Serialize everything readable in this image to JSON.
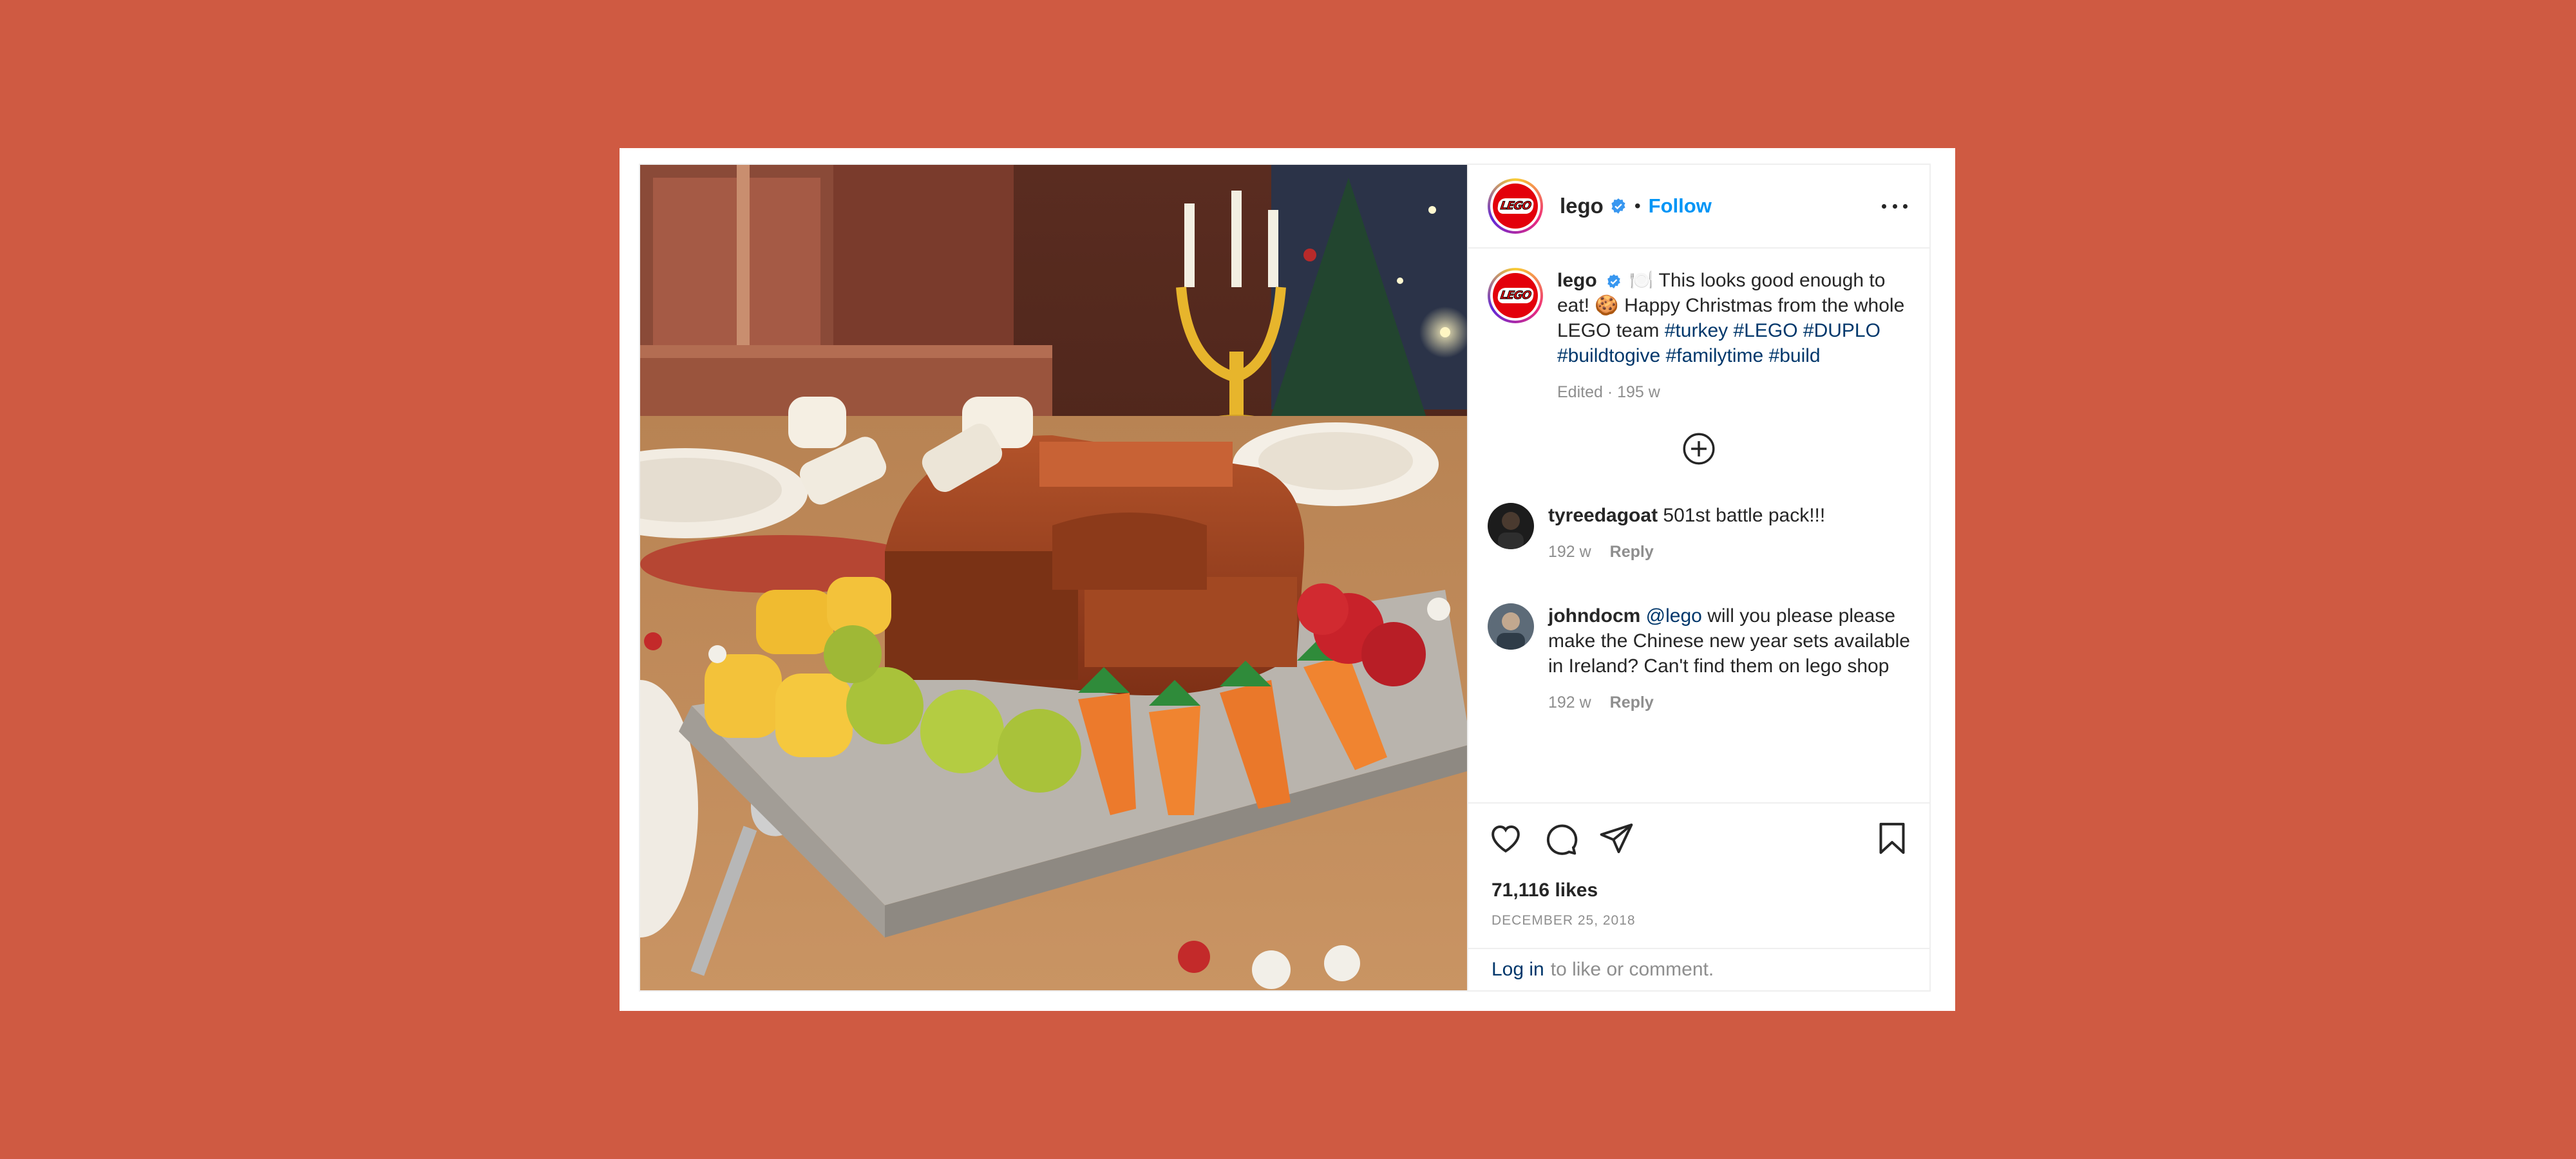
{
  "post": {
    "author": "lego",
    "follow_label": "Follow",
    "separator": "•",
    "caption": {
      "emoji_plate": "🍽️",
      "text_1": "This looks good enough to eat!",
      "emoji_cookie": "🍪",
      "text_2": "Happy Christmas from the whole LEGO team",
      "hashtags": [
        "#turkey",
        "#LEGO",
        "#DUPLO",
        "#buildtogive",
        "#familytime",
        "#build"
      ],
      "edited": "Edited · 195 w"
    },
    "comments": [
      {
        "user": "tyreedagoat",
        "text": "501st battle pack!!!",
        "age": "192 w",
        "reply": "Reply"
      },
      {
        "user": "johndocm",
        "mention": "@lego",
        "text": "will you please please make the Chinese new year sets available in Ireland? Can't find them on lego shop",
        "age": "192 w",
        "reply": "Reply"
      }
    ],
    "likes": "71,116 likes",
    "date": "DECEMBER 25, 2018",
    "login_link": "Log in",
    "login_text": "to like or comment."
  },
  "icons": {
    "verified": "verified-badge-icon",
    "more": "more-options-icon",
    "load_more": "plus-circle-icon",
    "like": "heart-icon",
    "comment": "comment-bubble-icon",
    "share": "paper-plane-icon",
    "save": "bookmark-icon"
  },
  "colors": {
    "background": "#CF5A42",
    "link_blue": "#0095f6",
    "hashtag": "#00376b",
    "muted": "#8e8e8e",
    "text": "#262626",
    "lego_red": "#e3000b"
  }
}
